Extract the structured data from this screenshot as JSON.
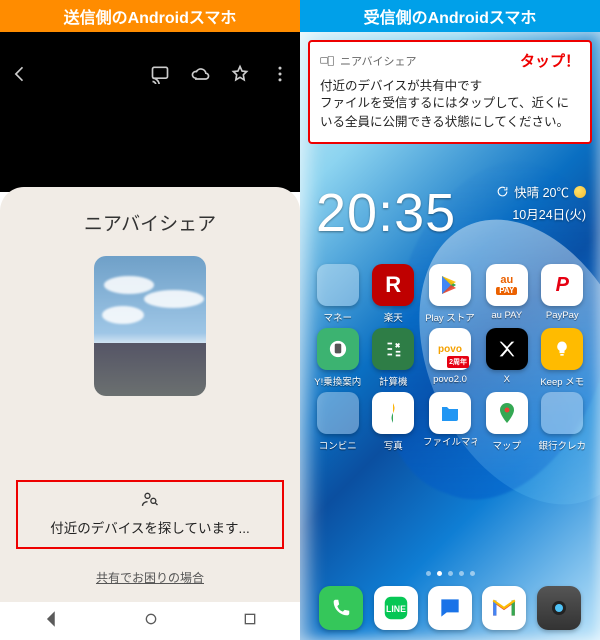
{
  "left": {
    "banner": "送信側のAndroidスマホ",
    "sheet_title": "ニアバイシェア",
    "searching": "付近のデバイスを探しています...",
    "help_link": "共有でお困りの場合"
  },
  "right": {
    "banner": "受信側のAndroidスマホ",
    "notif": {
      "app": "ニアバイシェア",
      "tap": "タップ！",
      "title": "付近のデバイスが共有中です",
      "body": "ファイルを受信するにはタップして、近くにいる全員に公開できる状態にしてください。"
    },
    "clock": "20:35",
    "weather_text": "快晴 20℃",
    "date": "10月24日(火)",
    "apps": {
      "r1": [
        "マネー",
        "楽天",
        "Play ストア",
        "au PAY",
        "PayPay"
      ],
      "r2": [
        "Y!乗換案内",
        "計算機",
        "povo2.0",
        "X",
        "Keep メモ"
      ],
      "r3": [
        "コンビニ",
        "写真",
        "ファイルマネージャー",
        "マップ",
        "銀行クレカ"
      ]
    }
  }
}
